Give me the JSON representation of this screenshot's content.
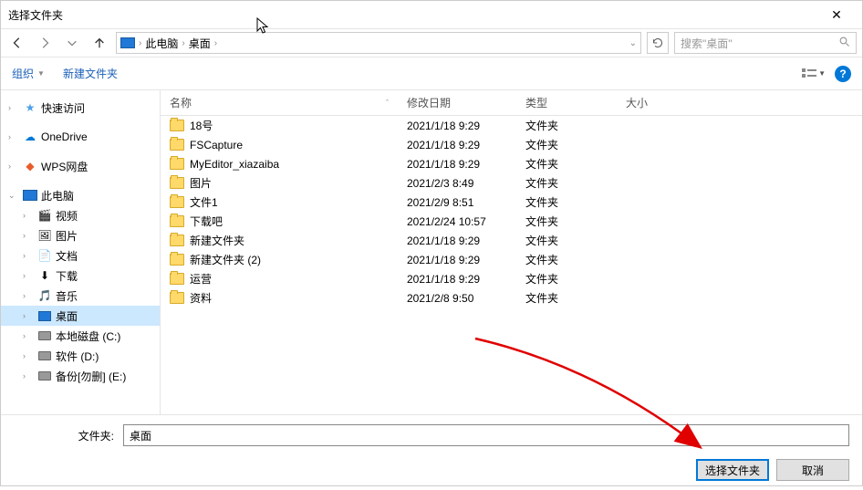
{
  "window": {
    "title": "选择文件夹"
  },
  "nav": {
    "path": [
      "此电脑",
      "桌面"
    ],
    "search_placeholder": "搜索\"桌面\""
  },
  "toolbar": {
    "organize": "组织",
    "new_folder": "新建文件夹"
  },
  "tree": {
    "quick_access": "快速访问",
    "onedrive": "OneDrive",
    "wps": "WPS网盘",
    "this_pc": "此电脑",
    "children": [
      {
        "label": "视频"
      },
      {
        "label": "图片"
      },
      {
        "label": "文档"
      },
      {
        "label": "下载"
      },
      {
        "label": "音乐"
      },
      {
        "label": "桌面",
        "selected": true
      },
      {
        "label": "本地磁盘 (C:)"
      },
      {
        "label": "软件 (D:)"
      },
      {
        "label": "备份[勿删] (E:)"
      }
    ]
  },
  "columns": {
    "name": "名称",
    "date": "修改日期",
    "type": "类型",
    "size": "大小"
  },
  "rows": [
    {
      "name": "18号",
      "date": "2021/1/18 9:29",
      "type": "文件夹"
    },
    {
      "name": "FSCapture",
      "date": "2021/1/18 9:29",
      "type": "文件夹"
    },
    {
      "name": "MyEditor_xiazaiba",
      "date": "2021/1/18 9:29",
      "type": "文件夹"
    },
    {
      "name": "图片",
      "date": "2021/2/3 8:49",
      "type": "文件夹"
    },
    {
      "name": "文件1",
      "date": "2021/2/9 8:51",
      "type": "文件夹"
    },
    {
      "name": "下载吧",
      "date": "2021/2/24 10:57",
      "type": "文件夹"
    },
    {
      "name": "新建文件夹",
      "date": "2021/1/18 9:29",
      "type": "文件夹"
    },
    {
      "name": "新建文件夹 (2)",
      "date": "2021/1/18 9:29",
      "type": "文件夹"
    },
    {
      "name": "运营",
      "date": "2021/1/18 9:29",
      "type": "文件夹"
    },
    {
      "name": "资料",
      "date": "2021/2/8 9:50",
      "type": "文件夹"
    }
  ],
  "footer": {
    "folder_label": "文件夹:",
    "folder_value": "桌面",
    "select": "选择文件夹",
    "cancel": "取消"
  }
}
